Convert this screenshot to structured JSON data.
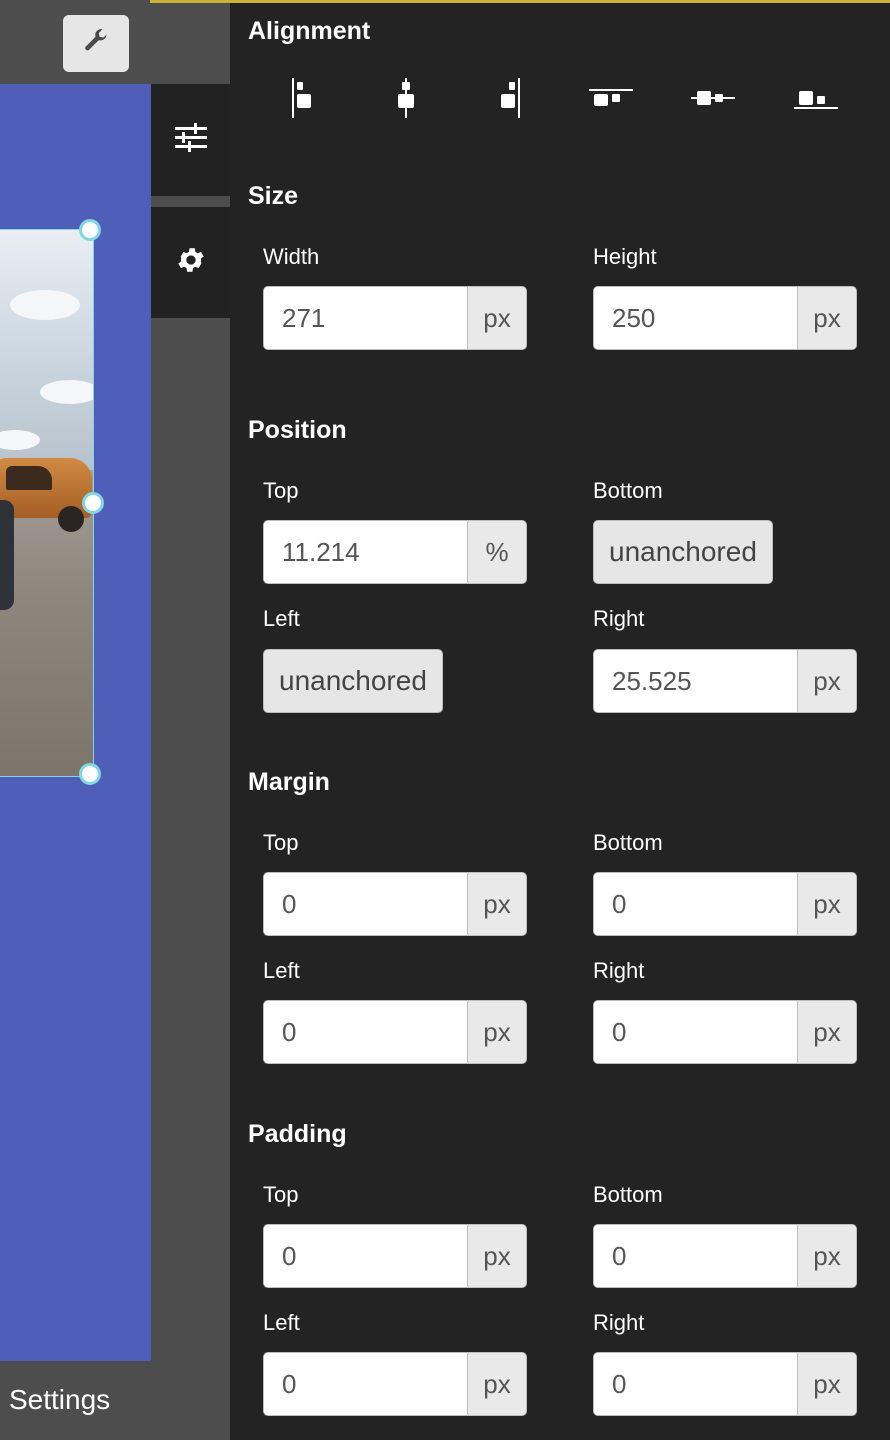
{
  "toolbar": {
    "wrench_icon": "wrench-icon"
  },
  "sidebar": {
    "tabs": [
      {
        "icon": "sliders-icon"
      },
      {
        "icon": "gear-icon"
      }
    ]
  },
  "footer": {
    "settings_label": "Settings"
  },
  "alignment": {
    "title": "Alignment",
    "buttons": [
      "align-left-icon",
      "align-center-horizontal-icon",
      "align-right-icon",
      "align-top-icon",
      "align-center-vertical-icon",
      "align-bottom-icon"
    ]
  },
  "size": {
    "title": "Size",
    "width": {
      "label": "Width",
      "value": "271",
      "unit": "px"
    },
    "height": {
      "label": "Height",
      "value": "250",
      "unit": "px"
    }
  },
  "position": {
    "title": "Position",
    "top": {
      "label": "Top",
      "value": "11.214",
      "unit": "%"
    },
    "bottom": {
      "label": "Bottom",
      "value": "unanchored"
    },
    "left": {
      "label": "Left",
      "value": "unanchored"
    },
    "right": {
      "label": "Right",
      "value": "25.525",
      "unit": "px"
    }
  },
  "margin": {
    "title": "Margin",
    "top": {
      "label": "Top",
      "value": "0",
      "unit": "px"
    },
    "bottom": {
      "label": "Bottom",
      "value": "0",
      "unit": "px"
    },
    "left": {
      "label": "Left",
      "value": "0",
      "unit": "px"
    },
    "right": {
      "label": "Right",
      "value": "0",
      "unit": "px"
    }
  },
  "padding": {
    "title": "Padding",
    "top": {
      "label": "Top",
      "value": "0",
      "unit": "px"
    },
    "bottom": {
      "label": "Bottom",
      "value": "0",
      "unit": "px"
    },
    "left": {
      "label": "Left",
      "value": "0",
      "unit": "px"
    },
    "right": {
      "label": "Right",
      "value": "0",
      "unit": "px"
    }
  },
  "colors": {
    "canvas": "#4f5eb8",
    "panel": "#232323",
    "selection": "#7fd7e3",
    "accent_line": "#c9b43a"
  }
}
